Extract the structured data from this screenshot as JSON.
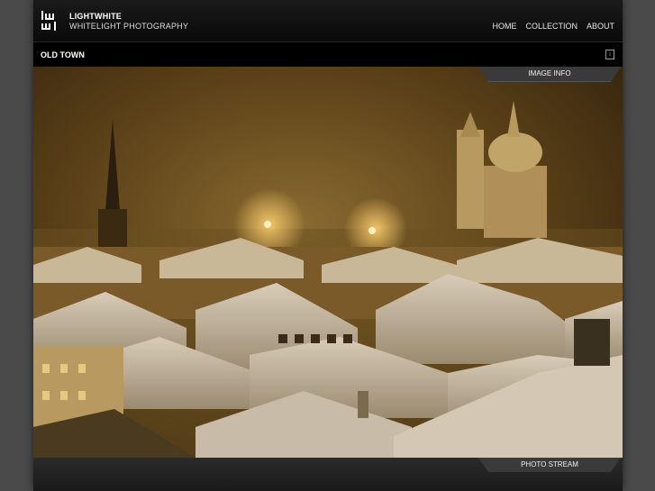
{
  "brand": {
    "name": "LIGHTWHITE",
    "tagline": "WHITELIGHT PHOTOGRAPHY",
    "logo_text": "lw wl"
  },
  "nav": {
    "items": [
      {
        "label": "HOME"
      },
      {
        "label": "COLLECTION"
      },
      {
        "label": "ABOUT"
      }
    ]
  },
  "page": {
    "title": "OLD TOWN",
    "info_icon": "info-icon",
    "image_info_label": "IMAGE INFO",
    "photo_stream_label": "PHOTO STREAM"
  },
  "colors": {
    "background": "#4a4a4a",
    "header": "#0a0a0a",
    "titlebar": "#000000",
    "tab": "#3a3a3a",
    "photo_glow": "#8a5a20"
  }
}
